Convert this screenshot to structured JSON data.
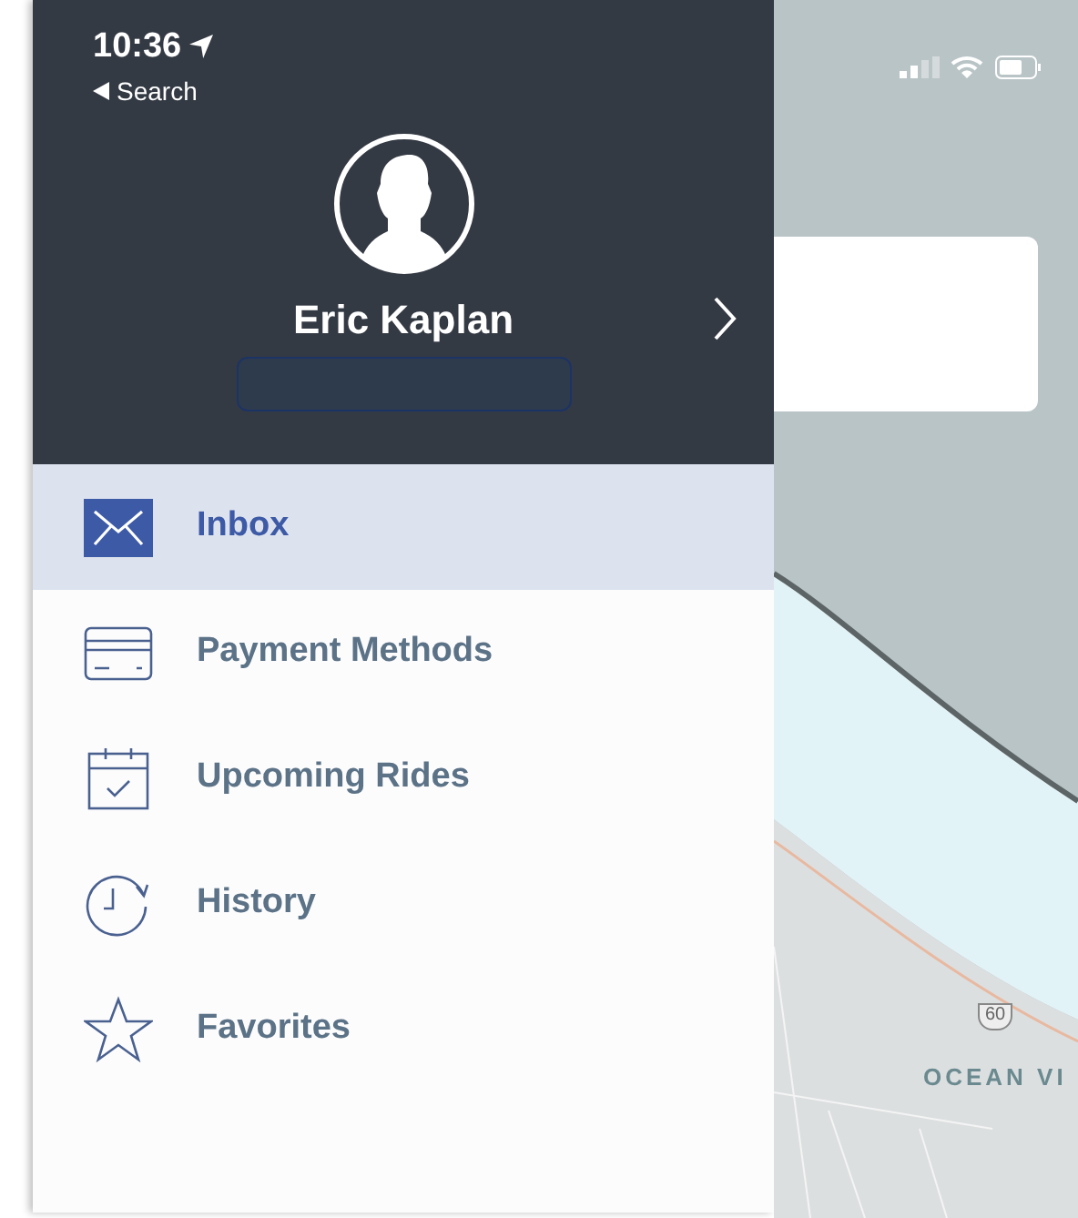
{
  "status_bar": {
    "time": "10:36",
    "back_label": "Search"
  },
  "profile": {
    "name": "Eric Kaplan"
  },
  "menu": [
    {
      "kind": "inbox",
      "label": "Inbox",
      "selected": true
    },
    {
      "kind": "card",
      "label": "Payment Methods",
      "selected": false
    },
    {
      "kind": "calendar",
      "label": "Upcoming Rides",
      "selected": false
    },
    {
      "kind": "history",
      "label": "History",
      "selected": false
    },
    {
      "kind": "star",
      "label": "Favorites",
      "selected": false
    }
  ],
  "map": {
    "labels": [
      {
        "kind": "shield",
        "text": "60"
      },
      {
        "kind": "area",
        "text": "OCEAN VI"
      }
    ]
  }
}
